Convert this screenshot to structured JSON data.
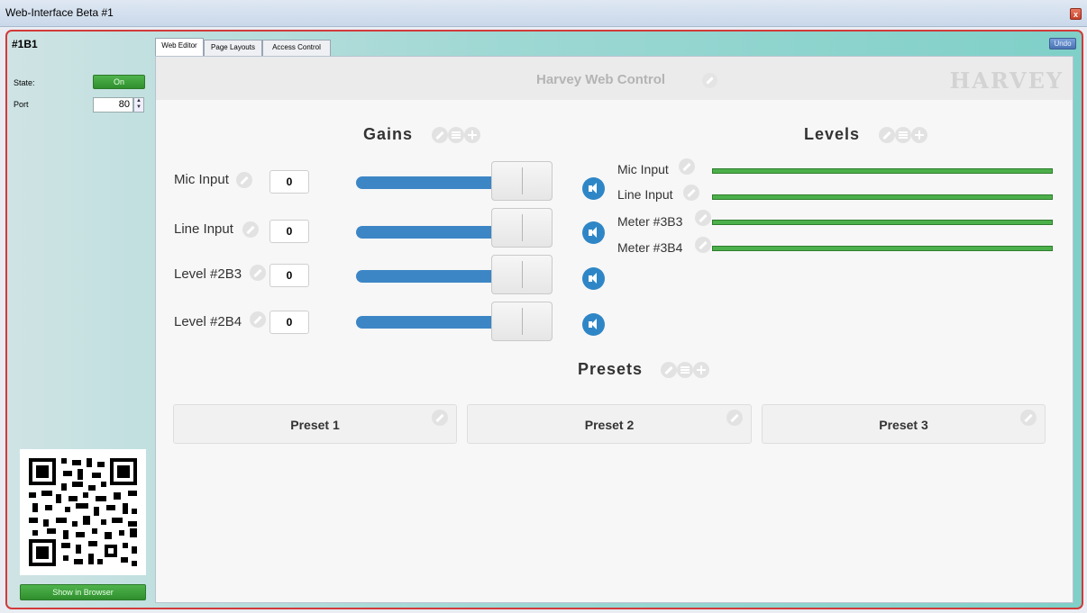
{
  "window": {
    "title": "Web-Interface Beta #1"
  },
  "left_panel": {
    "device_id": "#1B1",
    "state_label": "State:",
    "state_value": "On",
    "port_label": "Port",
    "port_value": "80",
    "show_browser_label": "Show in Browser"
  },
  "tabs": [
    {
      "label": "Web Editor",
      "active": true
    },
    {
      "label": "Page Layouts",
      "active": false
    },
    {
      "label": "Access Control",
      "active": false
    }
  ],
  "undo_label": "Undo",
  "header": {
    "title": "Harvey Web Control",
    "logo": "HARVEY"
  },
  "gains": {
    "title": "Gains",
    "items": [
      {
        "label": "Mic Input",
        "value": "0"
      },
      {
        "label": "Line Input",
        "value": "0"
      },
      {
        "label": "Level #2B3",
        "value": "0"
      },
      {
        "label": "Level #2B4",
        "value": "0"
      }
    ]
  },
  "levels": {
    "title": "Levels",
    "items": [
      {
        "label": "Mic Input"
      },
      {
        "label": "Line Input"
      },
      {
        "label": "Meter #3B3"
      },
      {
        "label": "Meter #3B4"
      }
    ]
  },
  "presets": {
    "title": "Presets",
    "items": [
      {
        "label": "Preset 1"
      },
      {
        "label": "Preset 2"
      },
      {
        "label": "Preset 3"
      }
    ]
  },
  "colors": {
    "accent_blue": "#2f86c6",
    "meter_green": "#4cb04a",
    "frame_red": "#d23a3a",
    "button_green": "#2f8f2d"
  },
  "icons": [
    "pencil-icon",
    "list-icon",
    "plus-icon",
    "speaker-icon",
    "qr-code",
    "close-icon",
    "spinner-arrows"
  ]
}
